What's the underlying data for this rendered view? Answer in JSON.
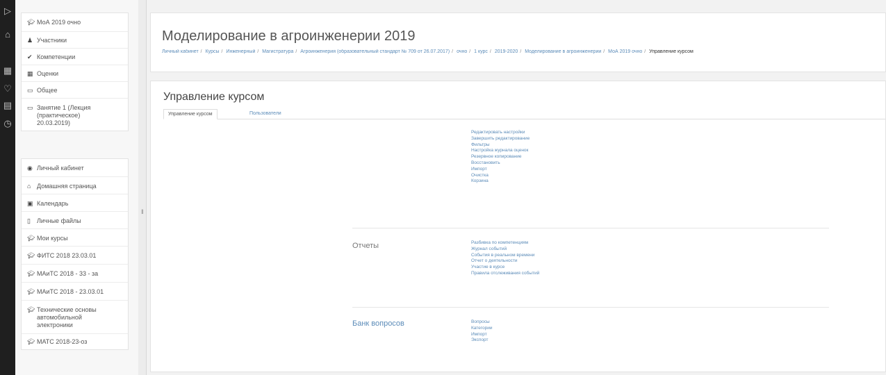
{
  "rail": {
    "icons": [
      "play-icon",
      "home-icon",
      "grid-icon",
      "heart-icon",
      "card-icon",
      "clock-icon"
    ]
  },
  "sidebar": {
    "course_nav": [
      {
        "icon": "graduation-cap-icon",
        "label": "МоА 2019 очно"
      },
      {
        "icon": "users-icon",
        "label": "Участники"
      },
      {
        "icon": "competency-icon",
        "label": "Компетенции"
      },
      {
        "icon": "grades-icon",
        "label": "Оценки"
      },
      {
        "icon": "folder-icon",
        "label": "Общее"
      },
      {
        "icon": "folder-icon",
        "label": "Занятие 1 (Лекция (практическое) 20.03.2019)"
      }
    ],
    "site_nav": [
      {
        "icon": "dashboard-icon",
        "label": "Личный кабинет"
      },
      {
        "icon": "home-icon",
        "label": "Домашняя страница"
      },
      {
        "icon": "calendar-icon",
        "label": "Календарь"
      },
      {
        "icon": "file-icon",
        "label": "Личные файлы"
      },
      {
        "icon": "graduation-cap-icon",
        "label": "Мои курсы"
      },
      {
        "icon": "graduation-cap-icon",
        "label": "ФИТС 2018 23.03.01"
      },
      {
        "icon": "graduation-cap-icon",
        "label": "МАиТС 2018 - 33 - за"
      },
      {
        "icon": "graduation-cap-icon",
        "label": "МАиТС 2018 - 23.03.01"
      },
      {
        "icon": "graduation-cap-icon",
        "label": "Технические основы автомобильной электроники"
      },
      {
        "icon": "graduation-cap-icon",
        "label": "МАТС 2018-23-оз"
      }
    ]
  },
  "header": {
    "title": "Моделирование в агроинженерии 2019",
    "breadcrumb": [
      "Личный кабинет",
      "Курсы",
      "Инженерный",
      "Магистратура",
      "Агроинженерия (образовательный стандарт № 709 от 26.07.2017)",
      "очно",
      "1 курс",
      "2019-2020",
      "Моделирование в агроинженерии",
      "МоА 2019 очно",
      "Управление курсом"
    ]
  },
  "main": {
    "section_title": "Управление курсом",
    "tabs": [
      "Управление курсом",
      "Пользователи"
    ],
    "course_links": [
      "Редактировать настройки",
      "Завершить редактирование",
      "Фильтры",
      "Настройка журнала оценок",
      "Резервное копирование",
      "Восстановить",
      "Импорт",
      "Очистка",
      "Корзина"
    ],
    "reports_label": "Отчеты",
    "reports_links": [
      "Разбивка по компетенциям",
      "Журнал событий",
      "События в реальном времени",
      "Отчет о деятельности",
      "Участие в курсе",
      "Правила отслеживания событий"
    ],
    "qbank_label": "Банк вопросов",
    "qbank_links": [
      "Вопросы",
      "Категории",
      "Импорт",
      "Экспорт"
    ]
  },
  "colors": {
    "rail_bg": "#1f1f1f",
    "link": "#5b8bb8",
    "page_bg": "#f2f2f2"
  }
}
